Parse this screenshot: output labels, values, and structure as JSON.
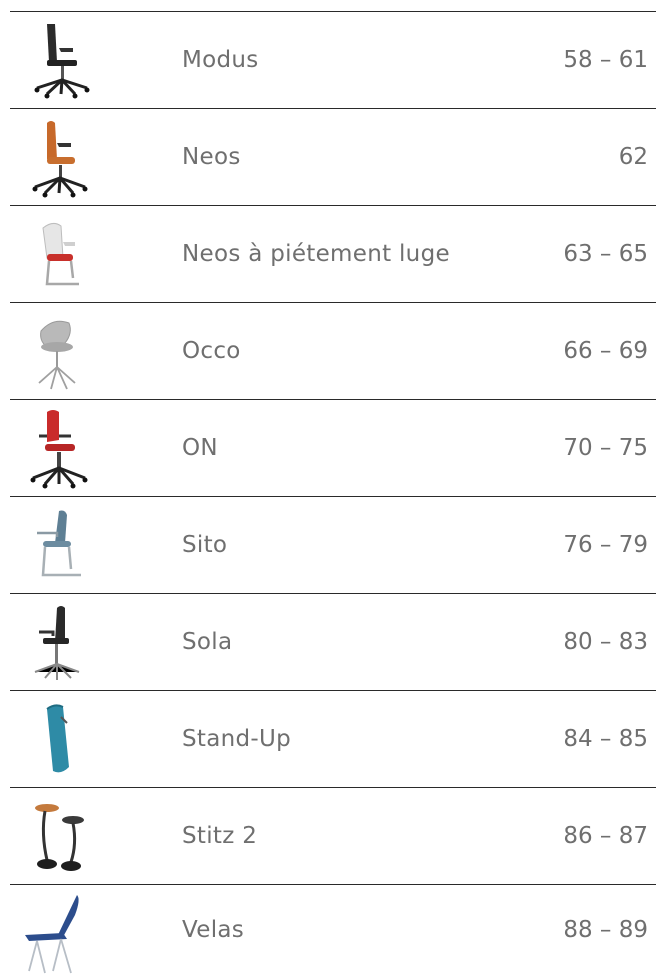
{
  "products": [
    {
      "name": "Modus",
      "pages": "58 – 61",
      "icon": "office-swivel-chair-icon"
    },
    {
      "name": "Neos",
      "pages": "62",
      "icon": "orange-swivel-chair-icon"
    },
    {
      "name": "Neos à piétement luge",
      "pages": "63 – 65",
      "icon": "cantilever-chair-red-seat-icon"
    },
    {
      "name": "Occo",
      "pages": "66 – 69",
      "icon": "grey-shell-chair-icon"
    },
    {
      "name": "ON",
      "pages": "70 – 75",
      "icon": "red-task-chair-icon"
    },
    {
      "name": "Sito",
      "pages": "76 – 79",
      "icon": "blue-cantilever-chair-icon"
    },
    {
      "name": "Sola",
      "pages": "80 – 83",
      "icon": "black-conference-chair-icon"
    },
    {
      "name": "Stand-Up",
      "pages": "84 – 85",
      "icon": "teal-standing-seat-icon"
    },
    {
      "name": "Stitz 2",
      "pages": "86 – 87",
      "icon": "stools-icon"
    },
    {
      "name": "Velas",
      "pages": "88 – 89",
      "icon": "blue-lounge-chair-icon"
    }
  ]
}
